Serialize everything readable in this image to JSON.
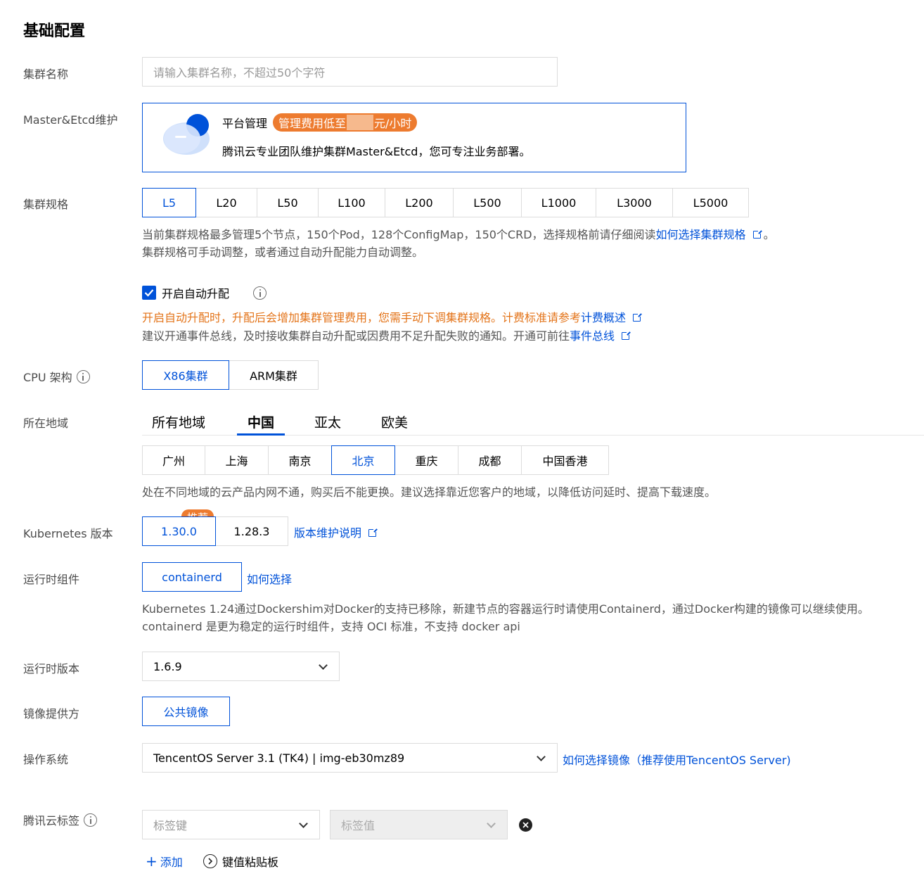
{
  "section_title": "基础配置",
  "cluster_name": {
    "label": "集群名称",
    "placeholder": "请输入集群名称，不超过50个字符"
  },
  "master": {
    "label": "Master&Etcd维护",
    "title": "平台管理",
    "badge_prefix": "管理费用低至",
    "badge_suffix": "元/小时",
    "desc": "腾讯云专业团队维护集群Master&Etcd，您可专注业务部署。"
  },
  "spec": {
    "label": "集群规格",
    "options": [
      "L5",
      "L20",
      "L50",
      "L100",
      "L200",
      "L500",
      "L1000",
      "L3000",
      "L5000"
    ],
    "selected": "L5",
    "hint_line1": "当前集群规格最多管理5个节点，150个Pod，128个ConfigMap，150个CRD，选择规格前请仔细阅读",
    "hint_link": "如何选择集群规格",
    "hint_end": "。",
    "hint_line2": "集群规格可手动调整，或者通过自动升配能力自动调整。"
  },
  "auto_upgrade": {
    "label": "开启自动升配",
    "checked": true,
    "warn_text": "开启自动升配时，升配后会增加集群管理费用，您需手动下调集群规格。计费标准请参考",
    "warn_link": "计费概述",
    "note_text": "建议开通事件总线，及时接收集群自动升配或因费用不足升配失败的通知。开通可前往",
    "note_link": "事件总线"
  },
  "cpu": {
    "label": "CPU 架构",
    "options": [
      "X86集群",
      "ARM集群"
    ],
    "selected": "X86集群"
  },
  "region": {
    "label": "所在地域",
    "tabs": [
      "所有地域",
      "中国",
      "亚太",
      "欧美"
    ],
    "active_tab": "中国",
    "cities": [
      "广州",
      "上海",
      "南京",
      "北京",
      "重庆",
      "成都",
      "中国香港"
    ],
    "selected_city": "北京",
    "hint": "处在不同地域的云产品内网不通，购买后不能更换。建议选择靠近您客户的地域，以降低访问延时、提高下载速度。"
  },
  "k8s": {
    "label": "Kubernetes 版本",
    "options": [
      "1.30.0",
      "1.28.3"
    ],
    "selected": "1.30.0",
    "recommend_badge": "推荐",
    "link": "版本维护说明"
  },
  "runtime": {
    "label": "运行时组件",
    "option": "containerd",
    "link": "如何选择",
    "hint_line1": "Kubernetes 1.24通过Dockershim对Docker的支持已移除，新建节点的容器运行时请使用Containerd，通过Docker构建的镜像可以继续使用。",
    "hint_line2": "containerd 是更为稳定的运行时组件，支持 OCI 标准，不支持 docker api"
  },
  "runtime_version": {
    "label": "运行时版本",
    "value": "1.6.9"
  },
  "image_provider": {
    "label": "镜像提供方",
    "option": "公共镜像"
  },
  "os": {
    "label": "操作系统",
    "value": "TencentOS Server 3.1 (TK4) | img-eb30mz89",
    "link": "如何选择镜像（推荐使用TencentOS Server)"
  },
  "tags": {
    "label": "腾讯云标签",
    "key_placeholder": "标签键",
    "value_placeholder": "标签值",
    "add_label": "添加",
    "paste_label": "键值粘贴板"
  },
  "colors": {
    "accent": "#0052d9",
    "warn": "#e37318",
    "badge": "#ed7b2f"
  }
}
